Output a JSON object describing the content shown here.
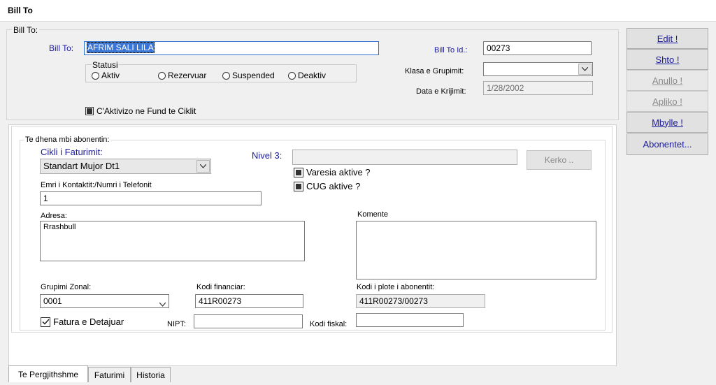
{
  "window": {
    "title": "Bill To"
  },
  "bill_to_group": {
    "caption": "Bill To:",
    "bill_to_label": "Bill To:",
    "bill_to_value": "AFRIM SALI LILA",
    "status": {
      "caption": "Statusi",
      "options": [
        "Aktiv",
        "Rezervuar",
        "Suspended",
        "Deaktiv"
      ]
    },
    "aktivizo_label": "C'Aktivizo ne Fund te Ciklit",
    "bill_to_id_label": "Bill To Id.:",
    "bill_to_id_value": "00273",
    "klasa_label": "Klasa e Grupimit:",
    "klasa_value": "",
    "data_label": "Data e Krijimit:",
    "data_value": "1/28/2002"
  },
  "details_group": {
    "caption": "Te dhena mbi abonentin:",
    "cikli_label": "Cikli i Faturimit:",
    "cikli_value": "Standart Mujor Dt1",
    "nivel_label": "Nivel 3:",
    "nivel_value": "",
    "kerko_label": "Kerko ..",
    "varesia_label": "Varesia aktive ?",
    "cug_label": "CUG aktive ?",
    "kontakt_label": "Emri  i Kontaktit:/Numri i Telefonit",
    "kontakt_value": "1",
    "adresa_label": "Adresa:",
    "adresa_value": "Rrashbull",
    "komente_label": "Komente",
    "komente_value": "",
    "grupimi_label": "Grupimi Zonal:",
    "grupimi_value": "0001",
    "kodi_fin_label": "Kodi financiar:",
    "kodi_fin_value": "411R00273",
    "kodi_plote_label": "Kodi i plote i abonentit:",
    "kodi_plote_value": "411R00273/00273",
    "fatura_label": "Fatura e Detajuar",
    "nipt_label": "NIPT:",
    "nipt_value": "",
    "kodi_fiskal_label": "Kodi fiskal:",
    "kodi_fiskal_value": ""
  },
  "buttons": {
    "edit": "Edit !",
    "shto": "Shto !",
    "anullo": "Anullo !",
    "apliko": "Apliko !",
    "mbylle": "Mbylle !",
    "abonentet": "Abonentet..."
  },
  "tabs": [
    "Te Pergjithshme",
    "Faturimi",
    "Historia"
  ]
}
